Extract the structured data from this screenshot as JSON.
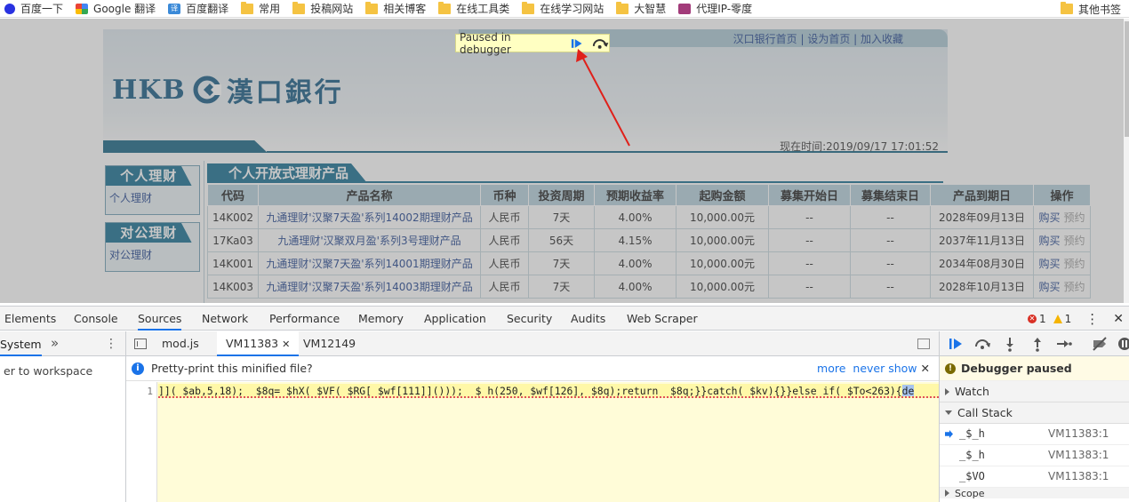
{
  "bookmarks": {
    "items": [
      {
        "label": "百度一下",
        "icon": "baidu-paw-icon"
      },
      {
        "label": "Google 翻译",
        "icon": "google-translate-icon"
      },
      {
        "label": "百度翻译",
        "icon": "baidu-translate-icon"
      },
      {
        "label": "常用",
        "icon": "folder-icon"
      },
      {
        "label": "投稿网站",
        "icon": "folder-icon"
      },
      {
        "label": "相关博客",
        "icon": "folder-icon"
      },
      {
        "label": "在线工具类",
        "icon": "folder-icon"
      },
      {
        "label": "在线学习网站",
        "icon": "folder-icon"
      },
      {
        "label": "大智慧",
        "icon": "folder-icon"
      },
      {
        "label": "代理IP-零度",
        "icon": "proxy-site-icon"
      }
    ],
    "other": "其他书签"
  },
  "bank": {
    "top_links": "汉口银行首页 | 设为首页 | 加入收藏",
    "logo_latin": "HKB",
    "logo_cn": "漢口銀行",
    "now_time_label": "现在时间:",
    "now_time_value": "2019/09/17  17:01:52",
    "side": [
      {
        "title": "个人理财",
        "item": "个人理财"
      },
      {
        "title": "对公理财",
        "item": "对公理财"
      }
    ],
    "product_title": "个人开放式理财产品",
    "columns": [
      "代码",
      "产品名称",
      "币种",
      "投资周期",
      "预期收益率",
      "起购金额",
      "募集开始日",
      "募集结束日",
      "产品到期日",
      "操作"
    ],
    "rows": [
      {
        "code": "14K002",
        "name": "九通理财'汉聚7天盈'系列14002期理财产品",
        "currency": "人民币",
        "period": "7天",
        "rate": "4.00%",
        "min": "10,000.00元",
        "start": "--",
        "end": "--",
        "maturity": "2028年09月13日",
        "buy": "购买",
        "reserve": "预约"
      },
      {
        "code": "17Ka03",
        "name": "九通理财'汉聚双月盈'系列3号理财产品",
        "currency": "人民币",
        "period": "56天",
        "rate": "4.15%",
        "min": "10,000.00元",
        "start": "--",
        "end": "--",
        "maturity": "2037年11月13日",
        "buy": "购买",
        "reserve": "预约"
      },
      {
        "code": "14K001",
        "name": "九通理财'汉聚7天盈'系列14001期理财产品",
        "currency": "人民币",
        "period": "7天",
        "rate": "4.00%",
        "min": "10,000.00元",
        "start": "--",
        "end": "--",
        "maturity": "2034年08月30日",
        "buy": "购买",
        "reserve": "预约"
      },
      {
        "code": "14K003",
        "name": "九通理财'汉聚7天盈'系列14003期理财产品",
        "currency": "人民币",
        "period": "7天",
        "rate": "4.00%",
        "min": "10,000.00元",
        "start": "--",
        "end": "--",
        "maturity": "2028年10月13日",
        "buy": "购买",
        "reserve": "预约"
      }
    ]
  },
  "paused_overlay": {
    "label": "Paused in debugger",
    "resume_icon": "resume-icon",
    "step_icon": "step-over-icon"
  },
  "annotation": {
    "color": "#e0201a"
  },
  "devtools": {
    "tabs": [
      "Elements",
      "Console",
      "Sources",
      "Network",
      "Performance",
      "Memory",
      "Application",
      "Security",
      "Audits",
      "Web Scraper"
    ],
    "active_tab": "Sources",
    "errors": "1",
    "warnings": "1",
    "navigator": {
      "tab": "System",
      "more": "»",
      "workspace_text": "er to workspace"
    },
    "editor_tabs": [
      {
        "label": "mod.js",
        "closable": false
      },
      {
        "label": "VM11383",
        "closable": true
      },
      {
        "label": "VM12149",
        "closable": false
      }
    ],
    "active_editor_tab": "VM11383",
    "pretty_print": {
      "text": "Pretty-print this minified file?",
      "more": "more",
      "never": "never show"
    },
    "code": {
      "line_number": "1",
      "before": "]](_$ab,5,18); _$8q=_$hX(_$VF(_$RG[_$wf[111]]())); _$_h(250,_$wf[126],_$8q);return _$8q;}}catch(_$kv){}}else if(_$To<263){",
      "highlight": "de"
    },
    "debugger": {
      "paused_label": "Debugger paused",
      "watch": "Watch",
      "call_stack": "Call Stack",
      "frames": [
        {
          "fn": "_$_h",
          "loc": "VM11383:1",
          "current": true
        },
        {
          "fn": "_$_h",
          "loc": "VM11383:1",
          "current": false
        },
        {
          "fn": "_$VO",
          "loc": "VM11383:1",
          "current": false
        }
      ],
      "scope_peek": "Scope"
    }
  }
}
